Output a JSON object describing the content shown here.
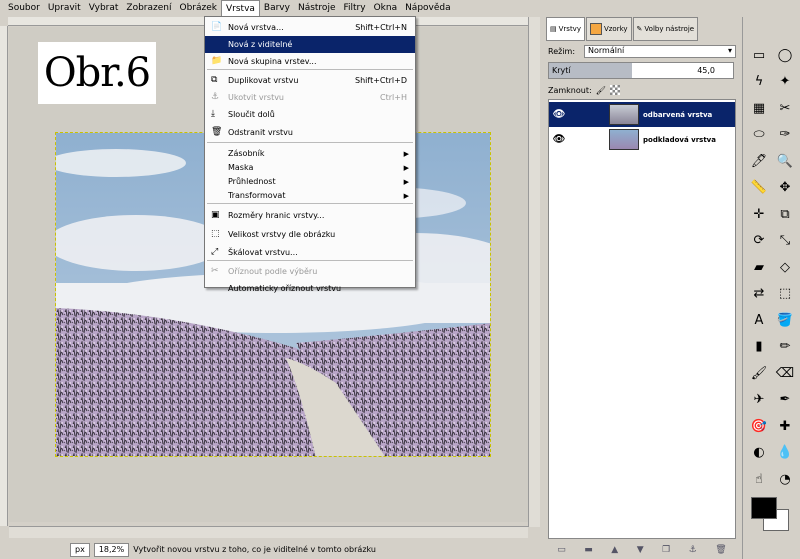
{
  "menubar": [
    "Soubor",
    "Upravit",
    "Vybrat",
    "Zobrazení",
    "Obrázek",
    "Vrstva",
    "Barvy",
    "Nástroje",
    "Filtry",
    "Okna",
    "Nápověda"
  ],
  "overlay_label": "Obr.6",
  "dropdown": {
    "items": [
      {
        "label": "Nová vrstva...",
        "shortcut": "Shift+Ctrl+N",
        "state": "normal"
      },
      {
        "label": "Nová z viditelné",
        "shortcut": "",
        "state": "highlight"
      },
      {
        "label": "Nová skupina vrstev...",
        "shortcut": "",
        "state": "normal"
      },
      {
        "label": "Duplikovat vrstvu",
        "shortcut": "Shift+Ctrl+D",
        "state": "normal"
      },
      {
        "label": "Ukotvit vrstvu",
        "shortcut": "Ctrl+H",
        "state": "disabled"
      },
      {
        "label": "Sloučit dolů",
        "shortcut": "",
        "state": "normal"
      },
      {
        "label": "Odstranit vrstvu",
        "shortcut": "",
        "state": "normal"
      },
      {
        "label": "Zásobník",
        "shortcut": "",
        "state": "submenu"
      },
      {
        "label": "Maska",
        "shortcut": "",
        "state": "submenu"
      },
      {
        "label": "Průhlednost",
        "shortcut": "",
        "state": "submenu"
      },
      {
        "label": "Transformovat",
        "shortcut": "",
        "state": "submenu"
      },
      {
        "label": "Rozměry hranic vrstvy...",
        "shortcut": "",
        "state": "normal"
      },
      {
        "label": "Velikost vrstvy dle obrázku",
        "shortcut": "",
        "state": "normal"
      },
      {
        "label": "Škálovat vrstvu...",
        "shortcut": "",
        "state": "normal"
      },
      {
        "label": "Oříznout podle výběru",
        "shortcut": "",
        "state": "disabled"
      },
      {
        "label": "Automaticky oříznout vrstvu",
        "shortcut": "",
        "state": "normal"
      }
    ]
  },
  "status": {
    "unit": "px",
    "zoom": "18,2%",
    "message": "Vytvořit novou vrstvu z toho, co je viditelné v tomto obrázku"
  },
  "panel": {
    "tabs": [
      "Vrstvy",
      "Vzorky",
      "Volby nástroje"
    ],
    "mode_label": "Režim:",
    "mode_value": "Normální",
    "opacity_label": "Krytí",
    "opacity_value": "45,0",
    "opacity_fraction": 0.45,
    "lock_label": "Zamknout:",
    "layers": [
      {
        "name": "odbarvená vrstva",
        "selected": true
      },
      {
        "name": "podkladová vrstva",
        "selected": false
      }
    ]
  },
  "colors": {
    "highlight": "#0a246a",
    "selection_border": "#c9c300",
    "fg": "#000000",
    "bg": "#ffffff"
  }
}
